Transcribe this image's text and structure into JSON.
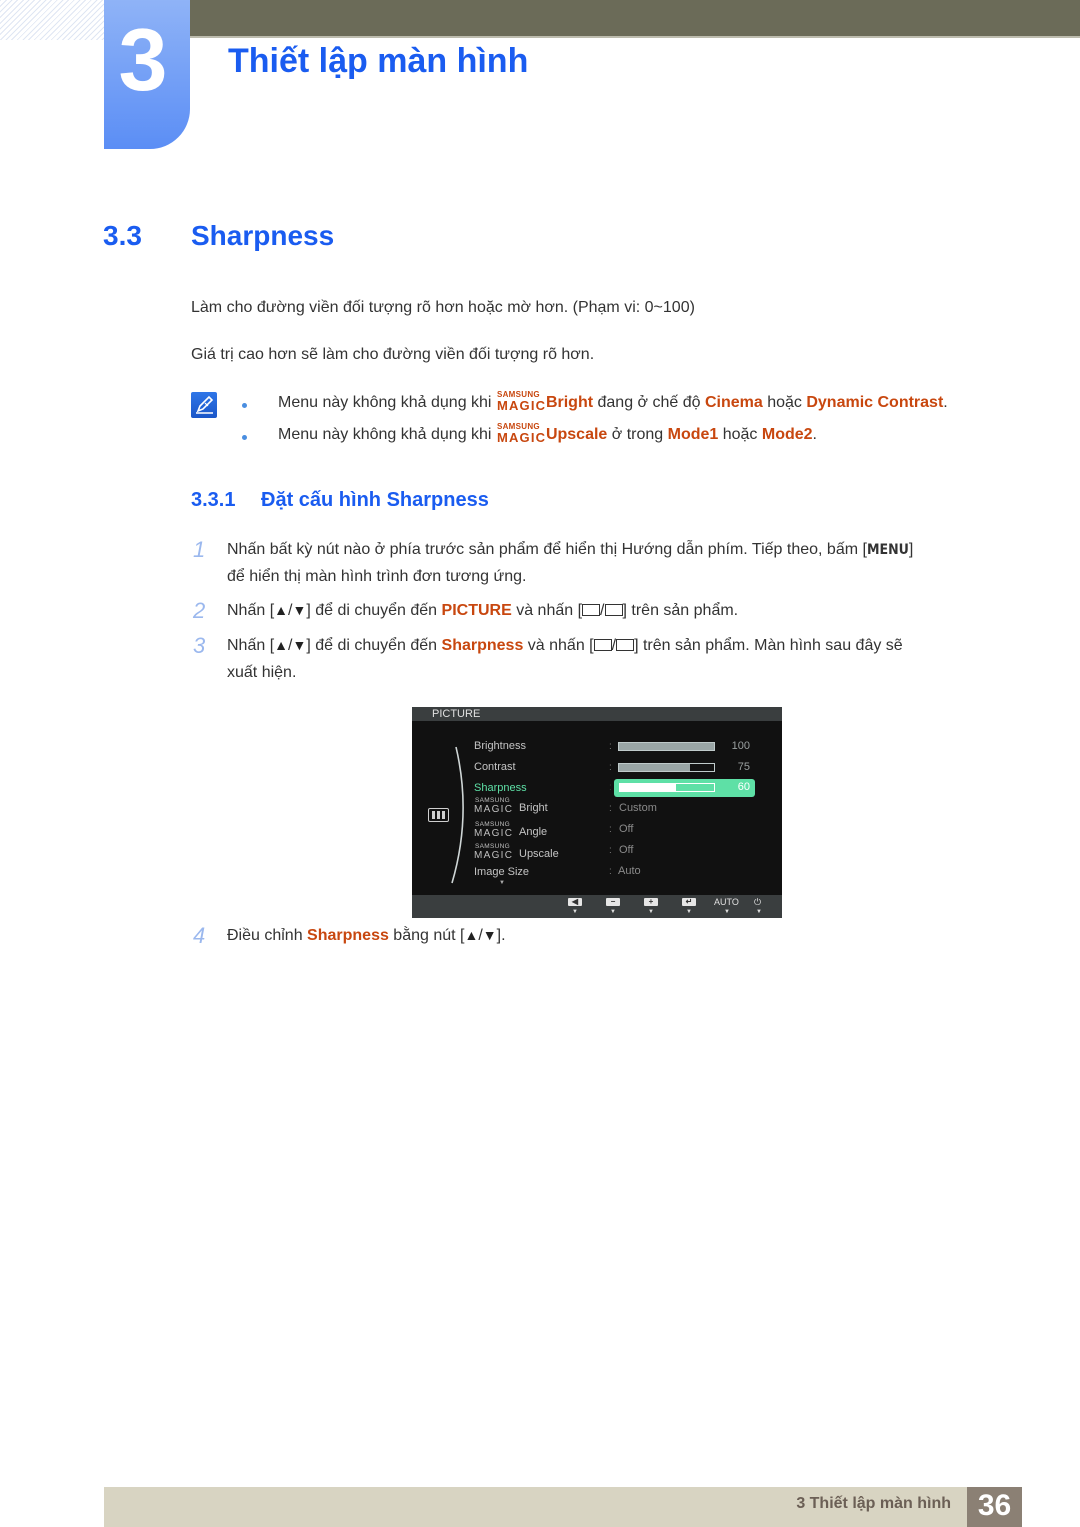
{
  "chapter": {
    "number": "3",
    "title": "Thiết lập màn hình"
  },
  "section": {
    "number": "3.3",
    "title": "Sharpness",
    "paragraphs": [
      "Làm cho đường viền đối tượng rõ hơn hoặc mờ hơn. (Phạm vi: 0~100)",
      "Giá trị cao hơn sẽ làm cho đường viền đối tượng rõ hơn."
    ]
  },
  "notes": [
    {
      "prefix": "Menu này không khả dụng khi ",
      "magic_top": "SAMSUNG",
      "magic_bottom": "MAGIC",
      "feature": "Bright",
      "mid": " đang ở chế độ ",
      "opt1": "Cinema",
      "join": " hoặc ",
      "opt2": "Dynamic Contrast",
      "end": "."
    },
    {
      "prefix": "Menu này không khả dụng khi ",
      "magic_top": "SAMSUNG",
      "magic_bottom": "MAGIC",
      "feature": "Upscale",
      "mid": " ở trong ",
      "opt1": "Mode1",
      "join": " hoặc ",
      "opt2": "Mode2",
      "end": "."
    }
  ],
  "subsection": {
    "number": "3.3.1",
    "title": "Đặt cấu hình Sharpness"
  },
  "steps": [
    {
      "num": "1",
      "line1_a": "Nhấn bất kỳ nút nào ở phía trước sản phẩm để hiển thị Hướng dẫn phím. Tiếp theo, bấm [",
      "key": "MENU",
      "line1_b": "]",
      "line2": "để hiển thị màn hình trình đơn tương ứng."
    },
    {
      "num": "2",
      "a": "Nhấn [",
      "up": "▲",
      "slash": "/",
      "down": "▼",
      "b": "] để di chuyển đến ",
      "target": "PICTURE",
      "c": " và nhấn [",
      "d": "] trên sản phẩm."
    },
    {
      "num": "3",
      "a": "Nhấn [",
      "up": "▲",
      "slash": "/",
      "down": "▼",
      "b": "] để di chuyển đến ",
      "target": "Sharpness",
      "c": " và nhấn [",
      "d": "] trên sản phẩm. Màn hình sau đây sẽ",
      "line2": "xuất hiện."
    },
    {
      "num": "4",
      "a": "Điều chỉnh ",
      "target": "Sharpness",
      "b": " bằng nút [",
      "up": "▲",
      "slash": "/",
      "down": "▼",
      "c": "]."
    }
  ],
  "osd": {
    "title": "PICTURE",
    "magic_top": "SAMSUNG",
    "magic_bottom": "MAGIC",
    "items": [
      {
        "label": "Brightness",
        "value": 100,
        "value_text": "100"
      },
      {
        "label": "Contrast",
        "value": 75,
        "value_text": "75"
      },
      {
        "label": "Sharpness",
        "value": 60,
        "value_text": "60",
        "selected": true
      },
      {
        "label": "Bright",
        "magic": true,
        "value_text": "Custom"
      },
      {
        "label": "Angle",
        "magic": true,
        "value_text": "Off"
      },
      {
        "label": "Upscale",
        "magic": true,
        "value_text": "Off"
      },
      {
        "label": "Image Size",
        "value_text": "Auto"
      }
    ],
    "more_indicator": "▼",
    "colon": ":",
    "keys": [
      {
        "name": "left",
        "glyph": "◀"
      },
      {
        "name": "minus",
        "glyph": "−"
      },
      {
        "name": "plus",
        "glyph": "+"
      },
      {
        "name": "enter",
        "glyph": "↵"
      },
      {
        "name": "auto",
        "glyph": "AUTO"
      },
      {
        "name": "power",
        "glyph": "⏻"
      }
    ],
    "key_caret": "▼",
    "accent_color": "#5ee0a6"
  },
  "footer": {
    "chapter_label": "3 Thiết lập màn hình",
    "page": "36"
  },
  "colors": {
    "heading_blue": "#1a5cf0",
    "highlight_orange": "#c8470f",
    "footer_bg": "#d8d4c2",
    "page_box": "#8b8074"
  }
}
